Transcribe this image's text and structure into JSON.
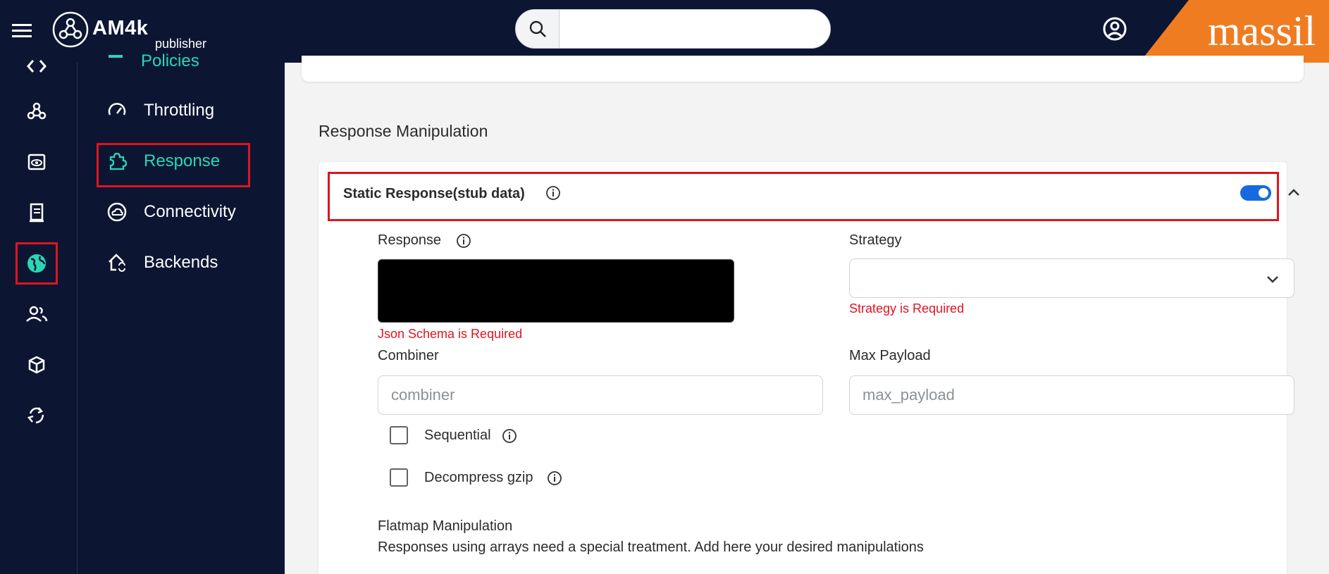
{
  "header": {
    "app_name": "AM4k",
    "app_sub": "publisher",
    "search_placeholder": "",
    "brand_text": "massil"
  },
  "rail": {
    "icons": [
      "code-icon",
      "webhook-icon",
      "eye-window-icon",
      "receipt-icon",
      "globe-icon",
      "people-icon",
      "cube-icon",
      "recycle-icon"
    ],
    "active_index": 4
  },
  "subnav": {
    "partial_label": "Policies",
    "items": [
      {
        "label": "Throttling",
        "icon": "speedometer-icon"
      },
      {
        "label": "Response",
        "icon": "puzzle-icon",
        "active": true
      },
      {
        "label": "Connectivity",
        "icon": "cloud-circle-icon"
      },
      {
        "label": "Backends",
        "icon": "house-sync-icon"
      }
    ]
  },
  "main": {
    "section_title": "Response Manipulation",
    "card": {
      "title": "Static Response(stub data)",
      "toggle_on": true,
      "response_label": "Response",
      "response_error": "Json Schema is Required",
      "strategy_label": "Strategy",
      "strategy_value": "",
      "strategy_error": "Strategy is Required",
      "combiner_label": "Combiner",
      "combiner_placeholder": "combiner",
      "max_payload_label": "Max Payload",
      "max_payload_placeholder": "max_payload",
      "sequential_label": "Sequential",
      "decompress_label": "Decompress gzip",
      "flatmap_title": "Flatmap Manipulation",
      "flatmap_desc": "Responses using arrays need a special treatment. Add here your desired manipulations"
    }
  },
  "colors": {
    "nav_bg": "#0c1633",
    "accent": "#2bd6b4",
    "brand": "#f07c22",
    "highlight": "#e0141e",
    "toggle": "#1769e0"
  }
}
